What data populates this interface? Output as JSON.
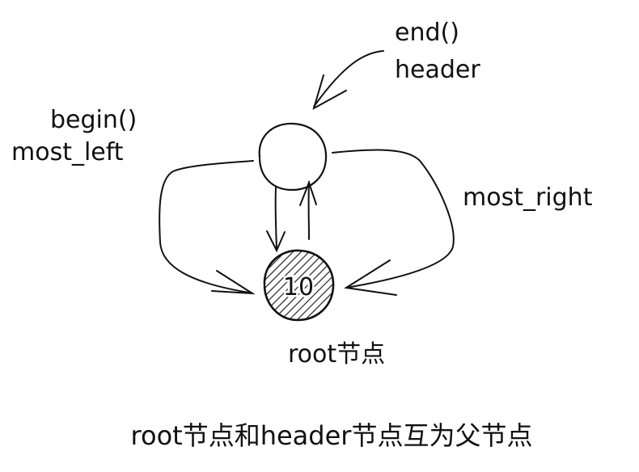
{
  "labels": {
    "end": "end()",
    "header": "header",
    "begin": "begin()",
    "most_left": "most_left",
    "most_right": "most_right",
    "node_value": "10",
    "root_label": "root节点",
    "caption": "root节点和header节点互为父节点"
  },
  "colors": {
    "ink": "#111111",
    "background": "#ffffff"
  }
}
